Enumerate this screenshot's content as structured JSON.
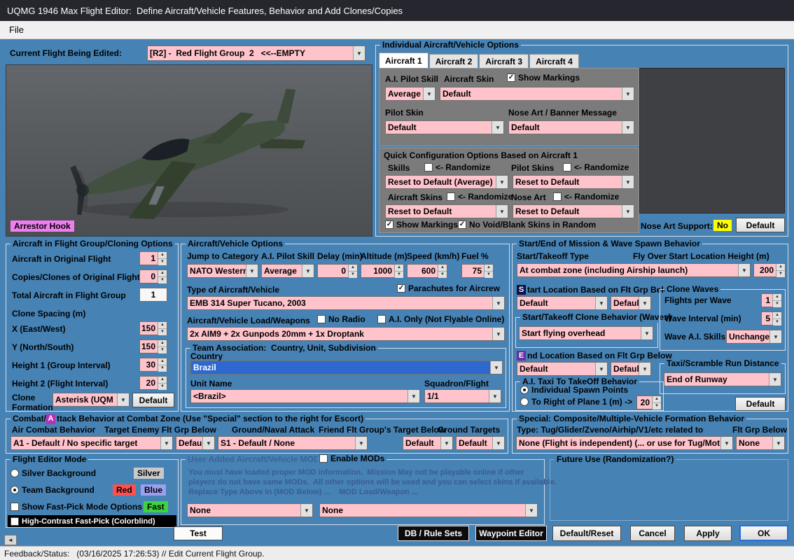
{
  "window": {
    "title": "UQMG 1946 Max Flight Editor:  Define Aircraft/Vehicle Features, Behavior and Add Clones/Copies",
    "menu_file": "File",
    "status": "Feedback/Status:   (03/16/2025 17:26:53) // Edit Current Flight Group."
  },
  "colors": {
    "background": "#4682B4",
    "control_pink": "#FFC3CB",
    "selection_blue": "#2E68CF",
    "badge_yellow": "#FFFF00",
    "badge_violet": "#F07EF0",
    "badge_green": "#3DD43D",
    "badge_red": "#FF5050",
    "badge_blue": "#9A9FF0",
    "badge_silver": "#C9C9C9"
  },
  "current_flight": {
    "label": "Current Flight Being Edited:",
    "value": "[R2] -  Red Flight Group  2   <<--EMPTY"
  },
  "preview": {
    "arrestor_hook": "Arrestor Hook"
  },
  "individual": {
    "title": "Individual Aircraft/Vehicle Options",
    "tabs": [
      "Aircraft 1",
      "Aircraft 2",
      "Aircraft 3",
      "Aircraft 4"
    ],
    "ai_pilot_skill_label": "A.I. Pilot Skill",
    "aircraft_skin_label": "Aircraft Skin",
    "show_markings_label": "Show Markings",
    "ai_pilot_skill_value": "Average",
    "aircraft_skin_value": "Default",
    "pilot_skin_label": "Pilot Skin",
    "nose_art_label": "Nose Art / Banner Message",
    "pilot_skin_value": "Default",
    "nose_art_value": "Default",
    "quick": {
      "title": "Quick Configuration Options Based on Aircraft 1",
      "skills_label": "Skills",
      "randomize_label": "<- Randomize",
      "pilot_skins_label": "Pilot Skins",
      "skills_value": "Reset to Default (Average)",
      "pilot_skins_value": "Reset to Default",
      "aircraft_skins_label": "Aircraft Skins",
      "nose_art_label": "Nose Art",
      "aircraft_skins_value": "Reset to Default",
      "nose_art_value": "Reset to Default",
      "show_markings_label": "Show Markings",
      "no_void_label": "No Void/Blank Skins in Random"
    },
    "nose_art_support_label": "Nose Art Support:",
    "nose_art_support_value": "No",
    "default_button": "Default"
  },
  "cloning": {
    "title": "Aircraft in Flight Group/Cloning Options",
    "original_label": "Aircraft in Original Flight",
    "original_value": "1",
    "copies_label": "Copies/Clones of Original Flight",
    "copies_value": "0",
    "total_label": "Total Aircraft in Flight Group",
    "total_value": "1",
    "spacing_label": "Clone Spacing (m)",
    "x_label": "X (East/West)",
    "x_value": "150",
    "y_label": "Y (North/South)",
    "y_value": "150",
    "h1_label": "Height 1 (Group Interval)",
    "h1_value": "30",
    "h2_label": "Height 2 (Flight Interval)",
    "h2_value": "20",
    "formation_label": "Clone Formation",
    "formation_value": "Asterisk (UQM",
    "default_button": "Default"
  },
  "vehicle": {
    "title": "Aircraft/Vehicle Options",
    "jump_label": "Jump to Category",
    "jump_value": "NATO Western",
    "skill_label": "A.I. Pilot Skill",
    "skill_value": "Average",
    "delay_label": "Delay (min)",
    "delay_value": "0",
    "altitude_label": "Altitude (m)",
    "altitude_value": "1000",
    "speed_label": "Speed (km/h)",
    "speed_value": "600",
    "fuel_label": "Fuel %",
    "fuel_value": "75",
    "type_label": "Type of Aircraft/Vehicle",
    "parachutes_label": "Parachutes for Aircrew",
    "type_value": "EMB 314 Super Tucano, 2003",
    "load_label": "Aircraft/Vehicle Load/Weapons",
    "no_radio_label": "No Radio",
    "ai_only_label": "A.I. Only (Not Flyable Online)",
    "load_value": "2x AIM9 + 2x Gunpods 20mm + 1x Droptank",
    "team": {
      "title": "Team Association:  Country, Unit, Subdivision",
      "country_label": "Country",
      "country_value": "Brazil",
      "unit_label": "Unit Name",
      "squadron_label": "Squadron/Flight",
      "unit_value": "<Brazil>",
      "squadron_value": "1/1"
    }
  },
  "spawn": {
    "title": "Start/End of Mission & Wave Spawn Behavior",
    "start_type_label": "Start/Takeoff Type",
    "fly_height_label": "Fly Over Start Location Height (m)",
    "start_type_value": "At combat zone (including Airship launch)",
    "fly_height_value": "200",
    "start_loc_prefix": "S",
    "start_loc_label": "tart Location Based on Flt Grp Below",
    "start_loc_value": "Default",
    "start_loc_value2": "Defaul",
    "clone_behavior_label": "Start/Takeoff Clone Behavior (Waves)",
    "clone_behavior_value": "Start flying overhead",
    "end_loc_prefix": "E",
    "end_loc_label": "nd Location Based on Flt Grp Below",
    "end_loc_value": "Default",
    "end_loc_value2": "Defaul",
    "taxi": {
      "title": "A.I. Taxi To TakeOff Behavior",
      "individual_label": "Individual Spawn Points",
      "right_label": "To Right of Plane 1 (m) ->",
      "right_value": "20"
    },
    "waves": {
      "title": "Clone Waves",
      "per_wave_label": "Flights per Wave",
      "per_wave_value": "1",
      "interval_label": "Wave Interval (min)",
      "interval_value": "5",
      "skills_label": "Wave A.I. Skills",
      "skills_value": "Unchange"
    },
    "taxi_run": {
      "title": "Taxi/Scramble Run Distance",
      "value": "End of Runway"
    },
    "default_button": "Default"
  },
  "combat": {
    "title_pre": "Combat/",
    "title_badge": "A",
    "title_post": "ttack Behavior at Combat Zone (Use \"Special\" section to the right for Escort)",
    "air_label": "Air Combat Behavior",
    "air_value": "A1 - Default / No specific target",
    "target_label": "Target Enemy Flt Grp Below",
    "target_value": "Defaul",
    "ground_label": "Ground/Naval Attack",
    "ground_value": "S1 - Default / None",
    "friend_label": "Friend Flt Group's Target Below",
    "friend_value": "Default",
    "targets_label": "Ground Targets",
    "targets_value": "Default"
  },
  "special": {
    "title": "Special: Composite/Multiple-Vehicle Formation Behavior",
    "type_label": "Type: Tug/Glider/Zveno/Airhip/V1/etc related to",
    "flt_label": "Flt Grp Below",
    "type_value": "None (Flight is independent) (... or use for Tug/Mothersl",
    "flt_value": "None"
  },
  "editor_mode": {
    "title": "Flight Editor Mode",
    "silver_label": "Silver Background",
    "silver_badge": "Silver",
    "team_label": "Team Background",
    "red_badge": "Red",
    "blue_badge": "Blue",
    "fastpick_label": "Show Fast-Pick Mode Options",
    "fast_badge": "Fast",
    "high_contrast_label": "High-Contrast Fast-Pick (Colorblind)"
  },
  "mods": {
    "title": "User Added Aircraft/Vehicle MODs",
    "enable_label": "Enable MODs",
    "line1": "You must have loaded proper MOD information.  Mission May not be playable online if other",
    "line2": "players do not have same MODs.  All other options will be used and you can select skins if available.",
    "line3": "Replace Type Above in (MOD Below) ...    MOD Load/Weapon ...",
    "mod_type_value": "None",
    "mod_load_value": "None"
  },
  "future": {
    "title": "Future Use (Randomization?)"
  },
  "buttons": {
    "test": "Test",
    "db": "DB / Rule Sets",
    "waypoint": "Waypoint Editor",
    "reset": "Default/Reset",
    "cancel": "Cancel",
    "apply": "Apply",
    "ok": "OK"
  }
}
